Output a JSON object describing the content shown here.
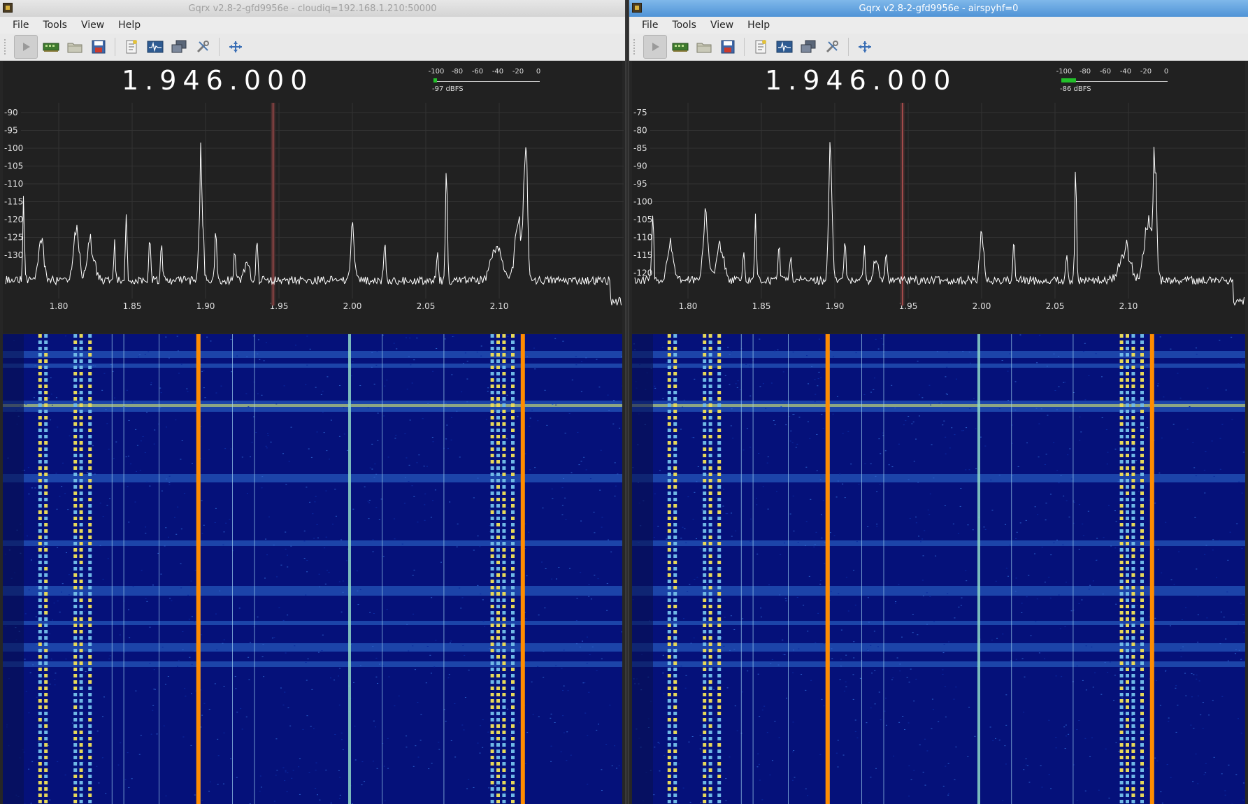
{
  "windows": [
    {
      "id": "left",
      "title": "Gqrx v2.8-2-gfd9956e - cloudiq=192.168.1.210:50000",
      "active": false,
      "menu": [
        "File",
        "Tools",
        "View",
        "Help"
      ],
      "frequency": "1.946.000",
      "meter": {
        "scale": [
          "-100",
          "-80",
          "-60",
          "-40",
          "-20",
          "0"
        ],
        "reading": "-97 dBFS",
        "level_dbfs": -97
      },
      "db_ticks": [
        "-90",
        "-95",
        "-100",
        "-105",
        "-110",
        "-115",
        "-120",
        "-125",
        "-130"
      ],
      "freq_ticks": [
        "1.80",
        "1.85",
        "1.90",
        "1.95",
        "2.00",
        "2.05",
        "2.10"
      ]
    },
    {
      "id": "right",
      "title": "Gqrx v2.8-2-gfd9956e - airspyhf=0",
      "active": true,
      "menu": [
        "File",
        "Tools",
        "View",
        "Help"
      ],
      "frequency": "1.946.000",
      "meter": {
        "scale": [
          "-100",
          "-80",
          "-60",
          "-40",
          "-20",
          "0"
        ],
        "reading": "-86 dBFS",
        "level_dbfs": -86
      },
      "db_ticks": [
        "-75",
        "-80",
        "-85",
        "-90",
        "-95",
        "-100",
        "-105",
        "-110",
        "-115",
        "-120"
      ],
      "freq_ticks": [
        "1.80",
        "1.85",
        "1.90",
        "1.95",
        "2.00",
        "2.05",
        "2.10"
      ]
    }
  ],
  "toolbar_icons": [
    "play-icon",
    "hardware-icon",
    "open-file-icon",
    "save-icon",
    "bookmark-icon",
    "spectrum-icon",
    "remote-icon",
    "tools-icon",
    "fit-icon"
  ],
  "colors": {
    "accent_title": "#4f93d6",
    "waterfall_bg": "#05117a",
    "strong_signal": "#ff8c00",
    "plot_bg": "#212121"
  }
}
